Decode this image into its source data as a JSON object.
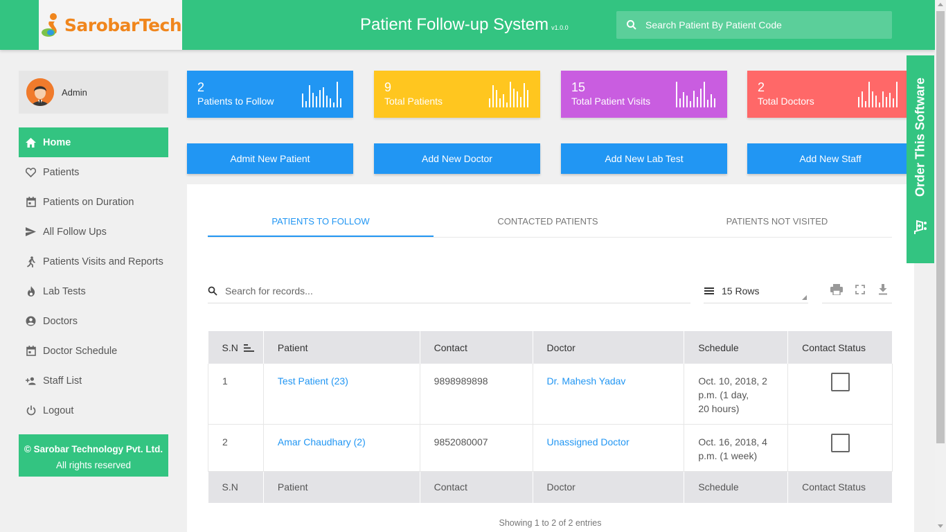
{
  "header": {
    "logo_text": "SarobarTech",
    "title": "Patient Follow-up System",
    "version": "v1.0.0",
    "search_placeholder": "Search Patient By Patient Code"
  },
  "user": {
    "name": "Admin"
  },
  "sidebar": {
    "items": [
      {
        "label": "Home",
        "icon": "home-icon"
      },
      {
        "label": "Patients",
        "icon": "heart-icon"
      },
      {
        "label": "Patients on Duration",
        "icon": "calendar-icon"
      },
      {
        "label": "All Follow Ups",
        "icon": "send-icon"
      },
      {
        "label": "Patients Visits and Reports",
        "icon": "walk-icon"
      },
      {
        "label": "Lab Tests",
        "icon": "flame-icon"
      },
      {
        "label": "Doctors",
        "icon": "account-circle-icon"
      },
      {
        "label": "Doctor Schedule",
        "icon": "calendar-icon"
      },
      {
        "label": "Staff List",
        "icon": "person-add-icon"
      },
      {
        "label": "Logout",
        "icon": "power-icon"
      }
    ],
    "footer_line1": "© Sarobar Technology Pvt. Ltd.",
    "footer_line2": "All rights reserved"
  },
  "stats": [
    {
      "value": "2",
      "label": "Patients to Follow",
      "color": "#2196f3"
    },
    {
      "value": "9",
      "label": "Total Patients",
      "color": "#ffc61f"
    },
    {
      "value": "15",
      "label": "Total Patient Visits",
      "color": "#c95de0"
    },
    {
      "value": "2",
      "label": "Total Doctors",
      "color": "#ff6868"
    }
  ],
  "actions": [
    "Admit New Patient",
    "Add New Doctor",
    "Add New Lab Test",
    "Add New Staff"
  ],
  "tabs": [
    "PATIENTS TO FOLLOW",
    "CONTACTED PATIENTS",
    "PATIENTS NOT VISITED"
  ],
  "records": {
    "search_placeholder": "Search for records...",
    "rows_label": "15 Rows",
    "showing": "Showing 1 to 2 of 2 entries"
  },
  "table": {
    "columns": [
      "S.N",
      "Patient",
      "Contact",
      "Doctor",
      "Schedule",
      "Contact Status"
    ],
    "rows": [
      {
        "sn": "1",
        "patient": "Test Patient (23)",
        "contact": "9898989898",
        "doctor": "Dr. Mahesh Yadav",
        "schedule_1": "Oct. 10, 2018, 2",
        "schedule_2": "p.m. (1 day,",
        "schedule_3": "20 hours)",
        "contacted": false
      },
      {
        "sn": "2",
        "patient": "Amar Chaudhary (2)",
        "contact": "9852080007",
        "doctor": "Unassigned Doctor",
        "schedule_1": "Oct. 16, 2018, 4",
        "schedule_2": "p.m. (1 week)",
        "schedule_3": "",
        "contacted": false
      }
    ]
  },
  "order_tab": {
    "label": "Order This Software"
  },
  "colors": {
    "brand_green": "#33c481",
    "primary_blue": "#2196f3",
    "logo_orange": "#f0861d"
  }
}
